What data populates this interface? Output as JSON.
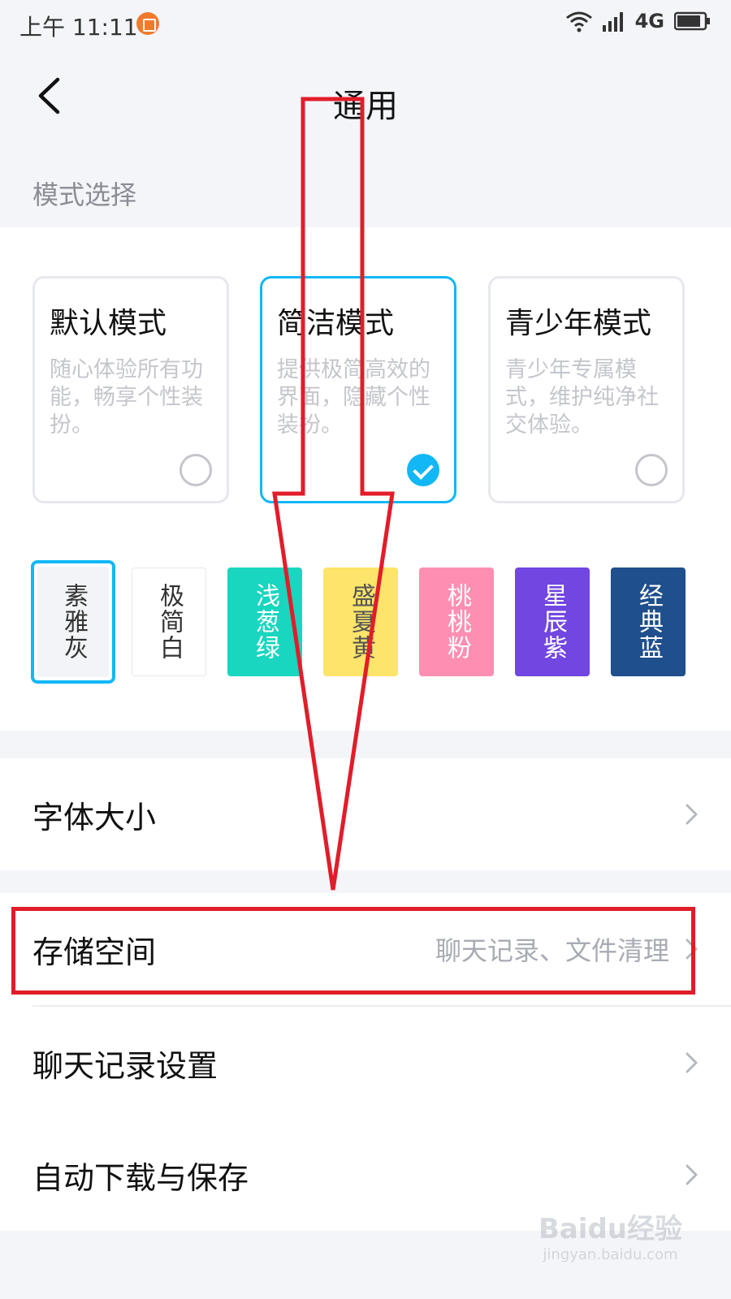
{
  "status": {
    "time": "上午 11:11",
    "network": "4G"
  },
  "nav": {
    "title": "通用"
  },
  "mode_section": {
    "label": "模式选择",
    "cards": [
      {
        "title": "默认模式",
        "desc": "随心体验所有功能，畅享个性装扮。",
        "selected": false
      },
      {
        "title": "简洁模式",
        "desc": "提供极简高效的界面，隐藏个性装扮。",
        "selected": true
      },
      {
        "title": "青少年模式",
        "desc": "青少年专属模式，维护纯净社交体验。",
        "selected": false
      }
    ],
    "themes": [
      {
        "name": "素雅灰",
        "bg": "#f3f4f7",
        "fg": "#333333",
        "selected": true
      },
      {
        "name": "极简白",
        "bg": "#ffffff",
        "fg": "#333333",
        "selected": false
      },
      {
        "name": "浅葱绿",
        "bg": "#18d6bf",
        "fg": "#ffffff",
        "selected": false
      },
      {
        "name": "盛夏黄",
        "bg": "#fde46a",
        "fg": "#555555",
        "selected": false
      },
      {
        "name": "桃桃粉",
        "bg": "#ff8fb2",
        "fg": "#ffffff",
        "selected": false
      },
      {
        "name": "星辰紫",
        "bg": "#7246e0",
        "fg": "#ffffff",
        "selected": false
      },
      {
        "name": "经典蓝",
        "bg": "#1f4f8c",
        "fg": "#ffffff",
        "selected": false
      }
    ]
  },
  "settings": {
    "font_size": {
      "label": "字体大小"
    },
    "storage": {
      "label": "存储空间",
      "value": "聊天记录、文件清理"
    },
    "chat_history": {
      "label": "聊天记录设置"
    },
    "auto_download": {
      "label": "自动下载与保存"
    }
  },
  "colors": {
    "accent": "#12b7f5",
    "annotation_red": "#e11d2a"
  },
  "watermark": {
    "logo": "Baidu经验",
    "url": "jingyan.baidu.com"
  }
}
